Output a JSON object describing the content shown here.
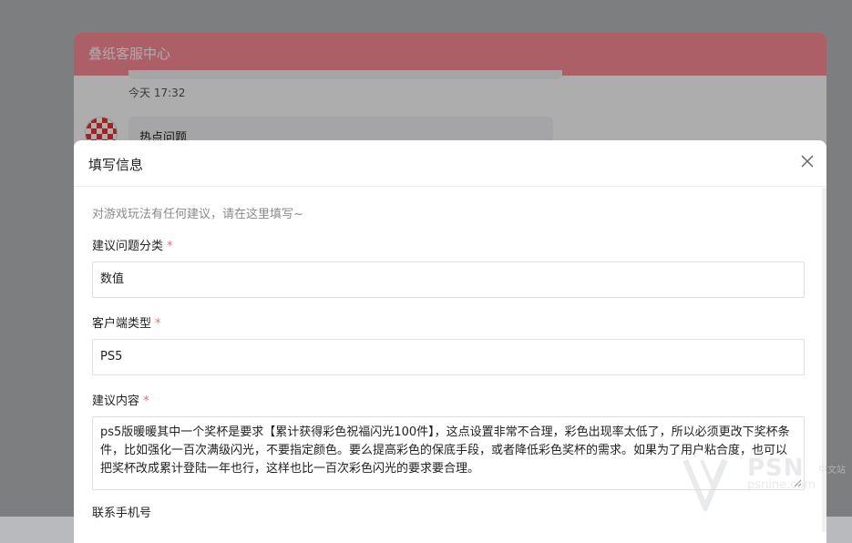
{
  "app": {
    "title": "叠纸客服中心"
  },
  "chat": {
    "timestamp": "今天 17:32",
    "bubble_text": "热点问题"
  },
  "dialog": {
    "title": "填写信息",
    "hint": "对游戏玩法有任何建议，请在这里填写~",
    "required_mark": "*",
    "fields": {
      "category": {
        "label": "建议问题分类",
        "value": "数值"
      },
      "client_type": {
        "label": "客户端类型",
        "value": "PS5"
      },
      "content": {
        "label": "建议内容",
        "value": "ps5版暖暖其中一个奖杯是要求【累计获得彩色祝福闪光100件】，这点设置非常不合理，彩色出现率太低了，所以必须更改下奖杯条件，比如强化一百次满级闪光，不要指定颜色。要么提高彩色的保底手段，或者降低彩色奖杯的需求。如果为了用户粘合度，也可以把奖杯改成累计登陆一年也行，这样也比一百次彩色闪光的要求要合理。"
      },
      "phone": {
        "label": "联系手机号"
      }
    }
  },
  "watermark": {
    "brand": "PSN",
    "cn": "中文站",
    "url": "psnine.com"
  },
  "colors": {
    "header_bg": "#fe8c98",
    "required": "#f56c6c"
  },
  "icons": {
    "close": "close-icon",
    "avatar": "avatar-image",
    "resize": "resize-handle-icon"
  }
}
